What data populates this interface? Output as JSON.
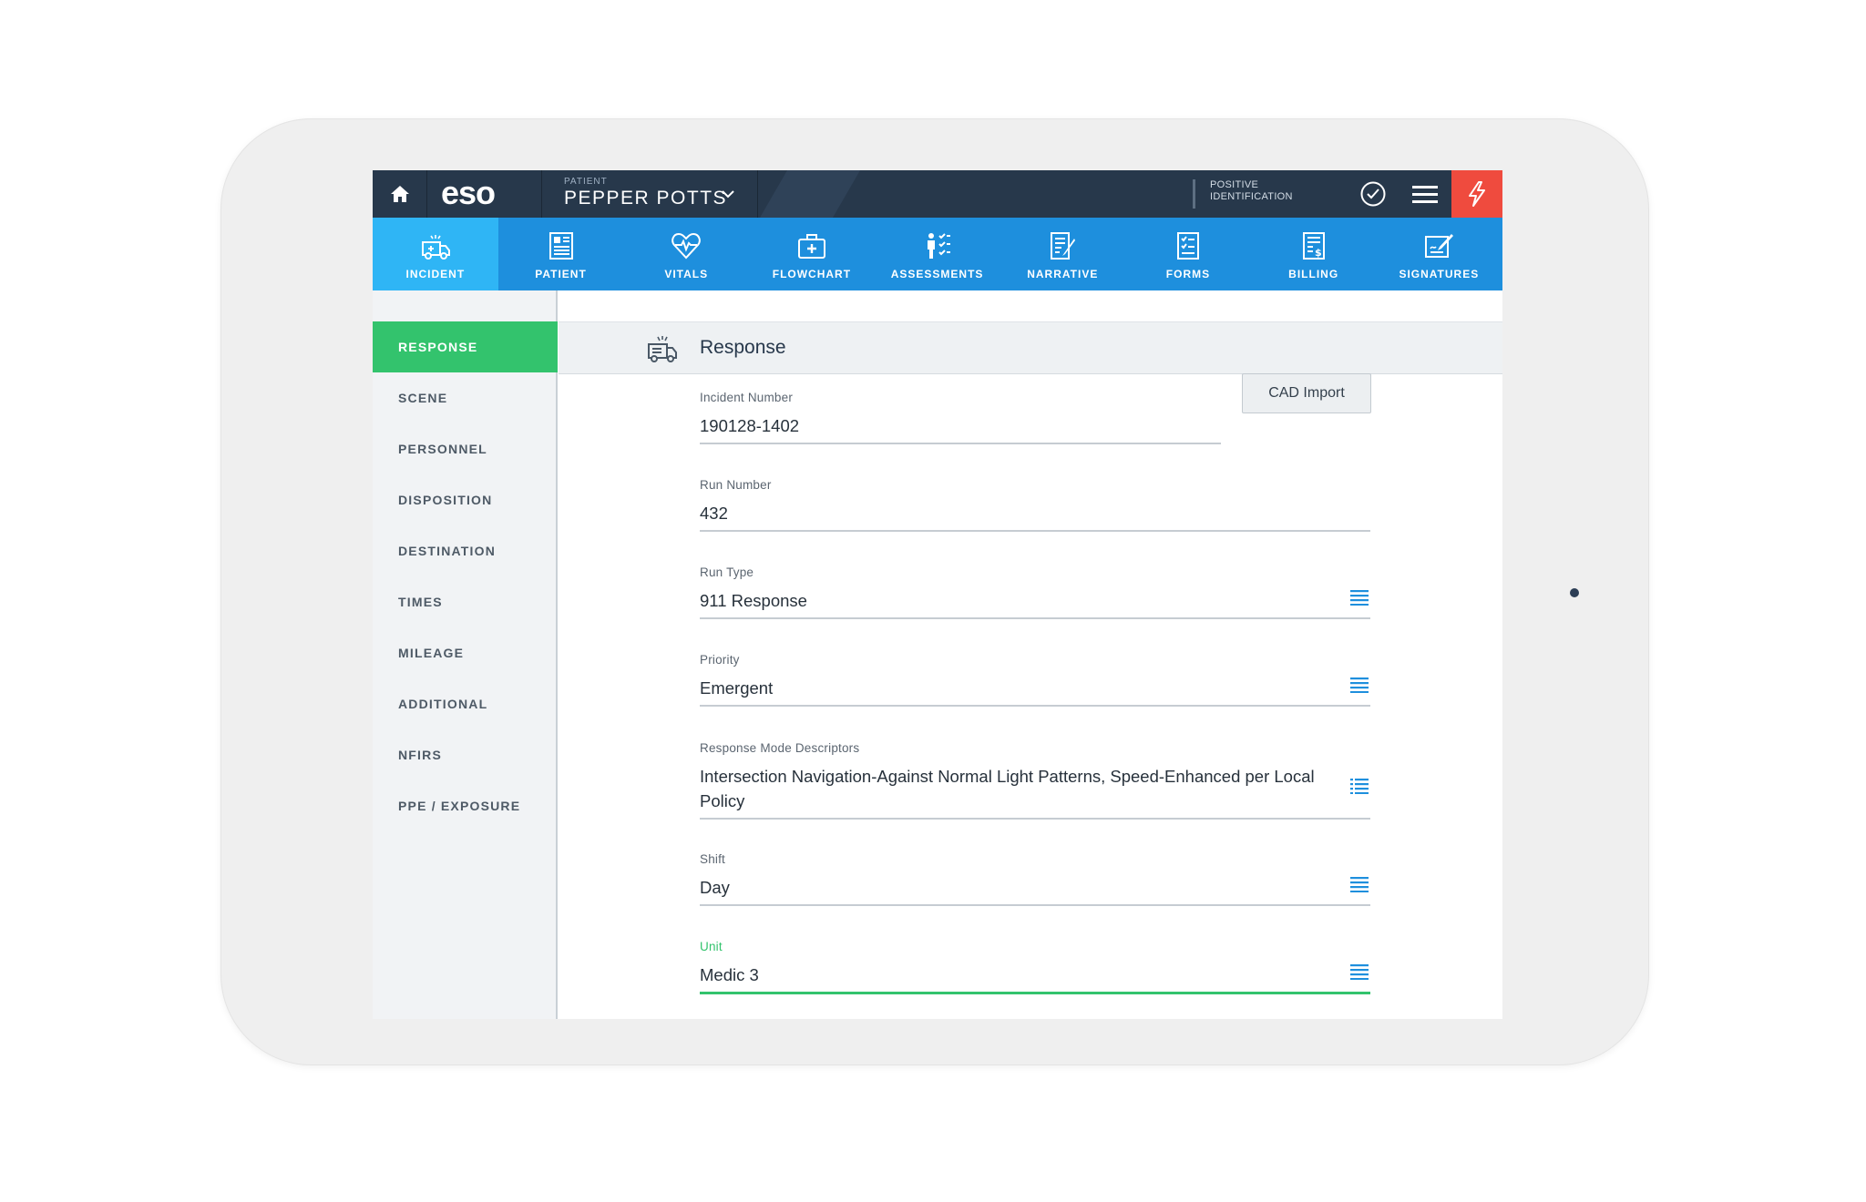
{
  "header": {
    "logo": "eso",
    "patient_caption": "PATIENT",
    "patient_name": "PEPPER POTTS",
    "positive_id_line1": "POSITIVE",
    "positive_id_line2": "IDENTIFICATION"
  },
  "tabs": [
    {
      "label": "INCIDENT",
      "icon": "ambulance-icon",
      "active": true
    },
    {
      "label": "PATIENT",
      "icon": "patient-chart-icon"
    },
    {
      "label": "VITALS",
      "icon": "heart-pulse-icon"
    },
    {
      "label": "FLOWCHART",
      "icon": "medical-bag-icon"
    },
    {
      "label": "ASSESSMENTS",
      "icon": "person-checklist-icon"
    },
    {
      "label": "NARRATIVE",
      "icon": "document-pen-icon"
    },
    {
      "label": "FORMS",
      "icon": "form-checklist-icon"
    },
    {
      "label": "BILLING",
      "icon": "billing-document-icon"
    },
    {
      "label": "SIGNATURES",
      "icon": "signature-icon"
    }
  ],
  "sidebar": {
    "items": [
      {
        "label": "RESPONSE",
        "active": true
      },
      {
        "label": "SCENE"
      },
      {
        "label": "PERSONNEL"
      },
      {
        "label": "DISPOSITION"
      },
      {
        "label": "DESTINATION"
      },
      {
        "label": "TIMES"
      },
      {
        "label": "MILEAGE"
      },
      {
        "label": "ADDITIONAL"
      },
      {
        "label": "NFIRS"
      },
      {
        "label": "PPE / EXPOSURE"
      }
    ]
  },
  "section": {
    "title": "Response",
    "cad_button": "CAD Import",
    "fields": {
      "incident_number": {
        "label": "Incident Number",
        "value": "190128-1402"
      },
      "run_number": {
        "label": "Run Number",
        "value": "432"
      },
      "run_type": {
        "label": "Run Type",
        "value": "911 Response"
      },
      "priority": {
        "label": "Priority",
        "value": "Emergent"
      },
      "response_mode": {
        "label": "Response Mode Descriptors",
        "value": "Intersection Navigation-Against Normal Light Patterns, Speed-Enhanced per Local Policy"
      },
      "shift": {
        "label": "Shift",
        "value": "Day"
      },
      "unit": {
        "label": "Unit",
        "value": "Medic 3"
      }
    }
  },
  "colors": {
    "header_bg": "#27384b",
    "tabbar_bg": "#1e8fdd",
    "tab_active_bg": "#2fb5f5",
    "sidebar_active": "#33c36d",
    "alert_red": "#ef4b3e",
    "list_icon_blue": "#1e8fdd"
  }
}
